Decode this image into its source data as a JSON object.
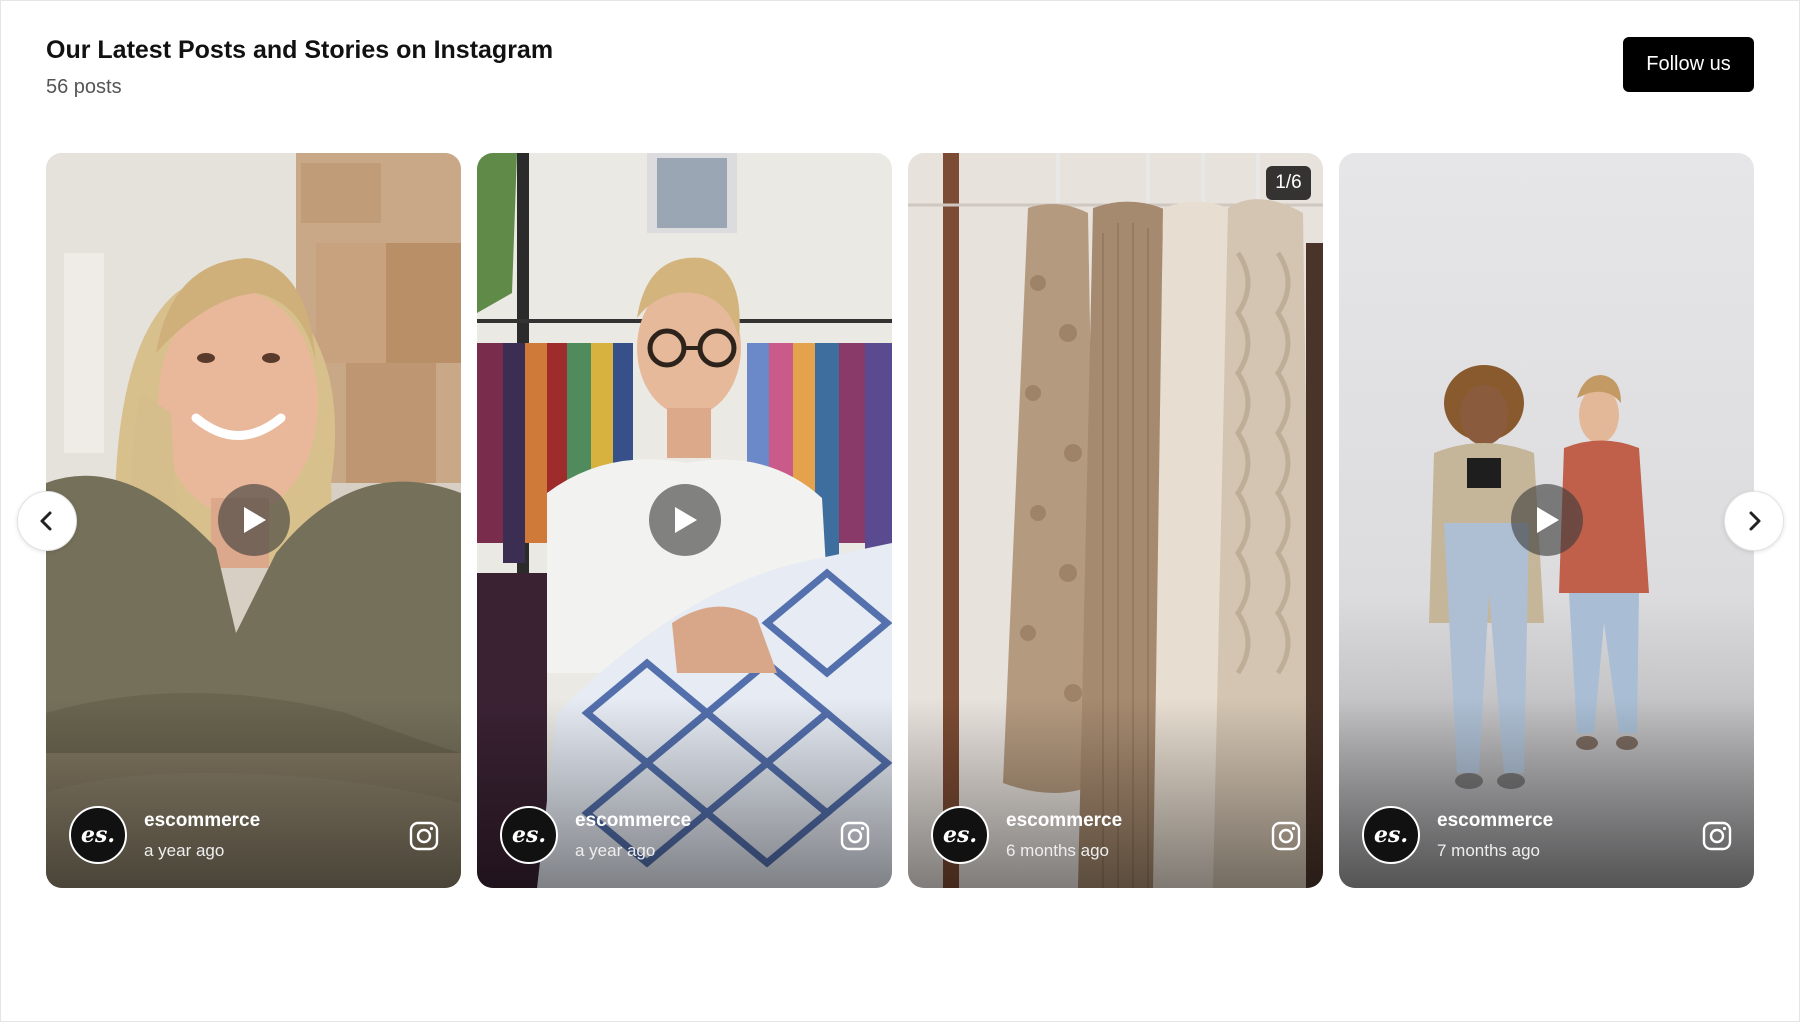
{
  "header": {
    "title": "Our Latest Posts and Stories on Instagram",
    "post_count": "56 posts",
    "follow_label": "Follow us"
  },
  "posts": [
    {
      "username": "escommerce",
      "time": "a year ago",
      "type": "video",
      "avatar_text": "es."
    },
    {
      "username": "escommerce",
      "time": "a year ago",
      "type": "video",
      "avatar_text": "es."
    },
    {
      "username": "escommerce",
      "time": "6 months ago",
      "type": "carousel",
      "slide_counter": "1/6",
      "avatar_text": "es."
    },
    {
      "username": "escommerce",
      "time": "7 months ago",
      "type": "video",
      "avatar_text": "es."
    }
  ],
  "icons": {
    "prev": "chevron-left-icon",
    "next": "chevron-right-icon",
    "play": "play-icon",
    "platform": "instagram-icon"
  },
  "colors": {
    "follow_bg": "#000000",
    "follow_text": "#ffffff",
    "title": "#111111",
    "subtitle": "#555555"
  }
}
